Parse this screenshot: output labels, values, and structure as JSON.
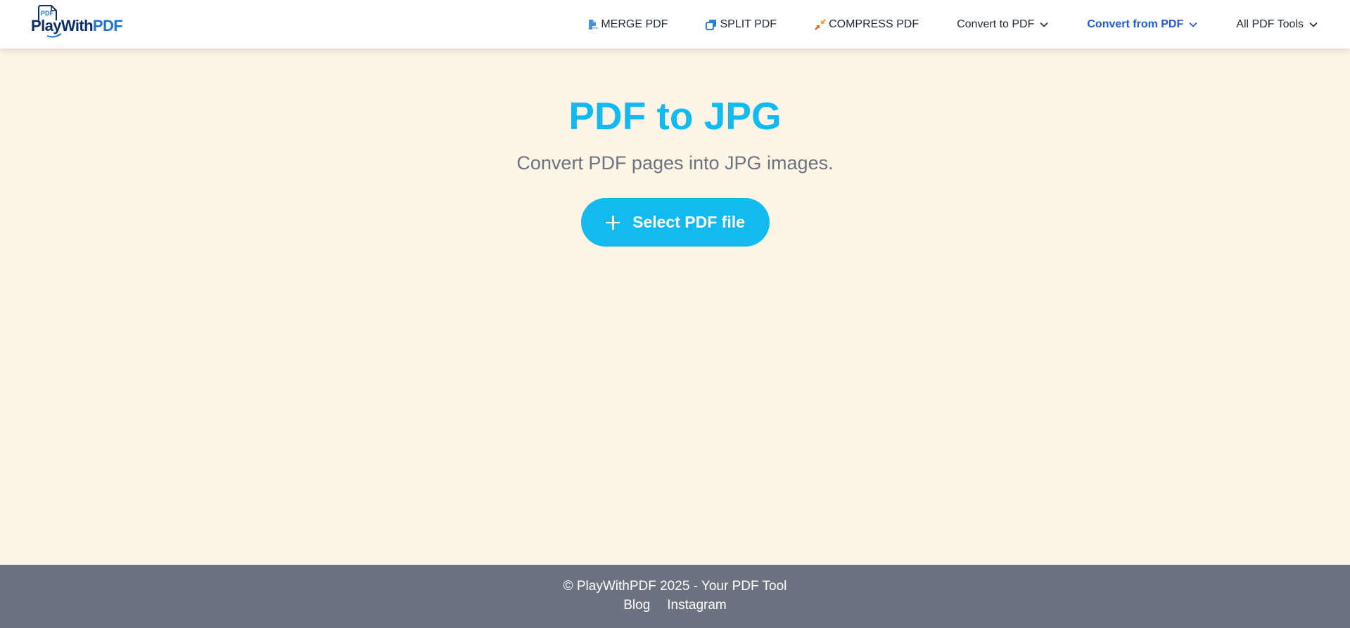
{
  "header": {
    "logo": {
      "play": "Play",
      "with": "With",
      "pdf": "PDF",
      "badge": "PDF"
    },
    "nav": [
      {
        "label": "MERGE PDF",
        "icon": "merge-pdf-icon"
      },
      {
        "label": "SPLIT PDF",
        "icon": "split-pdf-icon"
      },
      {
        "label": "COMPRESS PDF",
        "icon": "compress-pdf-icon"
      },
      {
        "label": "Convert to PDF",
        "icon": "chevron-down-icon"
      },
      {
        "label": "Convert from PDF",
        "icon": "chevron-down-icon",
        "active": true
      },
      {
        "label": "All PDF Tools",
        "icon": "chevron-down-icon"
      }
    ]
  },
  "main": {
    "title": "PDF to JPG",
    "subtitle": "Convert PDF pages into JPG images.",
    "select_button_label": "Select PDF file"
  },
  "footer": {
    "copyright": "© PlayWithPDF 2025 - Your PDF Tool",
    "links": [
      "Blog",
      "Instagram"
    ]
  },
  "colors": {
    "accent": "#12baf0",
    "active_nav": "#2259d6",
    "page_background": "#fcf5e6",
    "footer_background": "#6b7280",
    "brand_dark": "#0c2d63",
    "brand_blue": "#1f74d2"
  }
}
